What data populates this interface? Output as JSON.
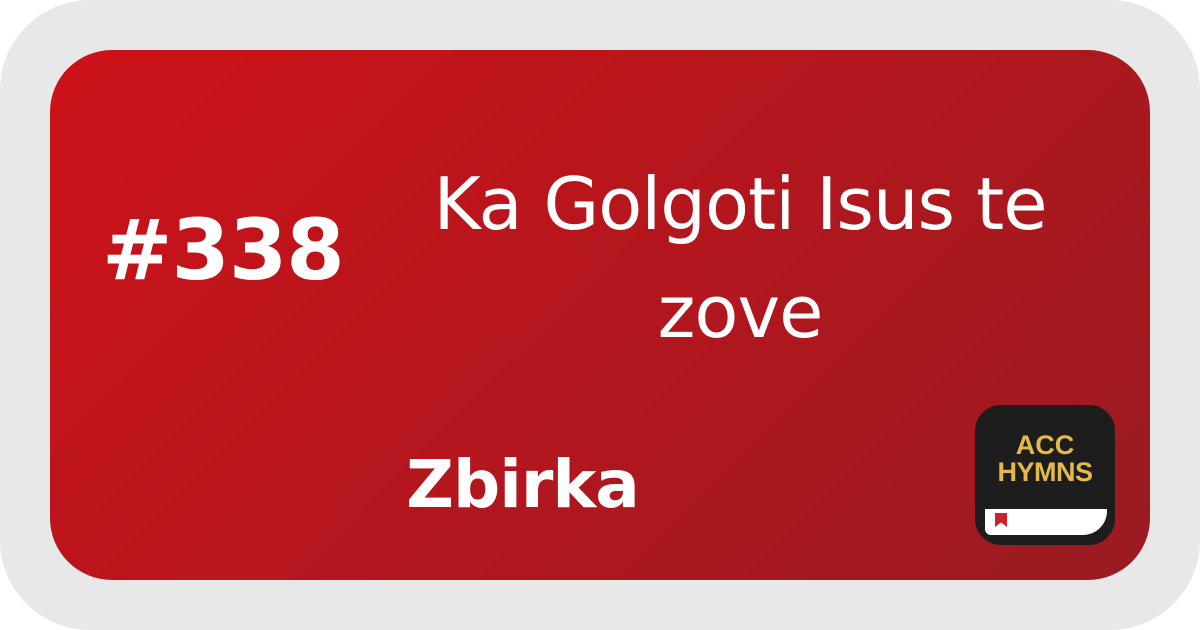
{
  "hymn": {
    "number": "#338",
    "title": "Ka Golgoti Isus te zove",
    "collection": "Zbirka"
  },
  "app_logo": {
    "line1": "ACC",
    "line2": "HYMNS"
  },
  "colors": {
    "card_gradient_start": "#cd1219",
    "card_gradient_end": "#991b22",
    "outer_frame": "#e8e8e8",
    "logo_background": "#1d1d1d",
    "logo_text": "#e4b84d",
    "bookmark": "#cc2229",
    "text": "#ffffff"
  },
  "icons": {
    "bookmark": "bookmark-icon"
  }
}
